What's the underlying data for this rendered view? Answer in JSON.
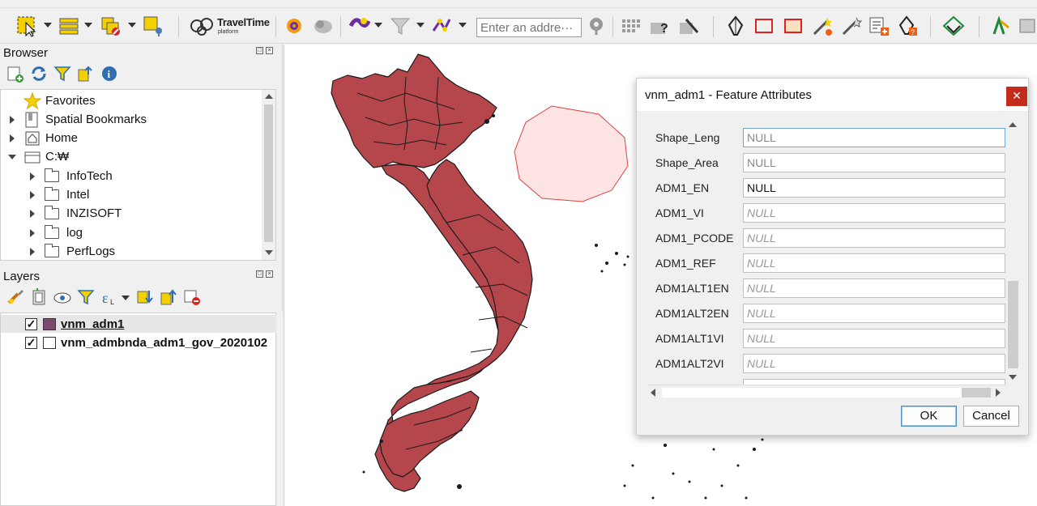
{
  "toolbar": {
    "travel_time_logo": "TravelTime",
    "travel_time_sub": "platform",
    "address_placeholder": "Enter an addre···",
    "icons": [
      "select-feature-icon",
      "attribute-table-icon",
      "deselect-icon",
      "identify-pin-icon",
      "traveltime-icon",
      "gear-icon",
      "plugin-icon",
      "filter-icon",
      "route-icon",
      "search-icon",
      "grid-icon",
      "help-icon",
      "tools-icon",
      "digitize-icon",
      "rectangle-icon",
      "resize-icon",
      "magic-wand-icon",
      "add-feature-icon",
      "remove-feature-icon",
      "qgis-logo-icon",
      "plugin-manager-icon"
    ]
  },
  "browser": {
    "title": "Browser",
    "items": [
      {
        "label": "Favorites",
        "icon": "star-icon",
        "expander": "none",
        "indent": 0
      },
      {
        "label": "Spatial Bookmarks",
        "icon": "bookmark-icon",
        "expander": "collapsed",
        "indent": 0
      },
      {
        "label": "Home",
        "icon": "home-icon",
        "expander": "collapsed",
        "indent": 0
      },
      {
        "label": "C:₩",
        "icon": "drive-icon",
        "expander": "expanded",
        "indent": 0
      },
      {
        "label": "InfoTech",
        "icon": "folder-icon",
        "expander": "collapsed",
        "indent": 1
      },
      {
        "label": "Intel",
        "icon": "folder-icon",
        "expander": "collapsed",
        "indent": 1
      },
      {
        "label": "INZISOFT",
        "icon": "folder-icon",
        "expander": "collapsed",
        "indent": 1
      },
      {
        "label": "log",
        "icon": "folder-icon",
        "expander": "collapsed",
        "indent": 1
      },
      {
        "label": "PerfLogs",
        "icon": "folder-icon",
        "expander": "collapsed",
        "indent": 1
      }
    ]
  },
  "layers": {
    "title": "Layers",
    "items": [
      {
        "label": "vnm_adm1",
        "checked": true,
        "underlined": true
      },
      {
        "label": "vnm_admbnda_adm1_gov_2020102",
        "checked": true,
        "underlined": false
      }
    ]
  },
  "dialog": {
    "title": "vnm_adm1 - Feature Attributes",
    "close_symbol": "✕",
    "fields": [
      {
        "label": "Shape_Leng",
        "value": "NULL",
        "style": "placeholder"
      },
      {
        "label": "Shape_Area",
        "value": "NULL",
        "style": "placeholder"
      },
      {
        "label": "ADM1_EN",
        "value": "NULL",
        "style": "normal"
      },
      {
        "label": "ADM1_VI",
        "value": "NULL",
        "style": "italic"
      },
      {
        "label": "ADM1_PCODE",
        "value": "NULL",
        "style": "italic"
      },
      {
        "label": "ADM1_REF",
        "value": "NULL",
        "style": "italic"
      },
      {
        "label": "ADM1ALT1EN",
        "value": "NULL",
        "style": "italic"
      },
      {
        "label": "ADM1ALT2EN",
        "value": "NULL",
        "style": "italic"
      },
      {
        "label": "ADM1ALT1VI",
        "value": "NULL",
        "style": "italic"
      },
      {
        "label": "ADM1ALT2VI",
        "value": "NULL",
        "style": "italic"
      }
    ],
    "ok_label": "OK",
    "cancel_label": "Cancel"
  },
  "map": {
    "land_color": "#b5464c",
    "border_color": "#1a1a1a",
    "sketch_fill": "#ffe4e4",
    "sketch_stroke": "#e04040"
  }
}
